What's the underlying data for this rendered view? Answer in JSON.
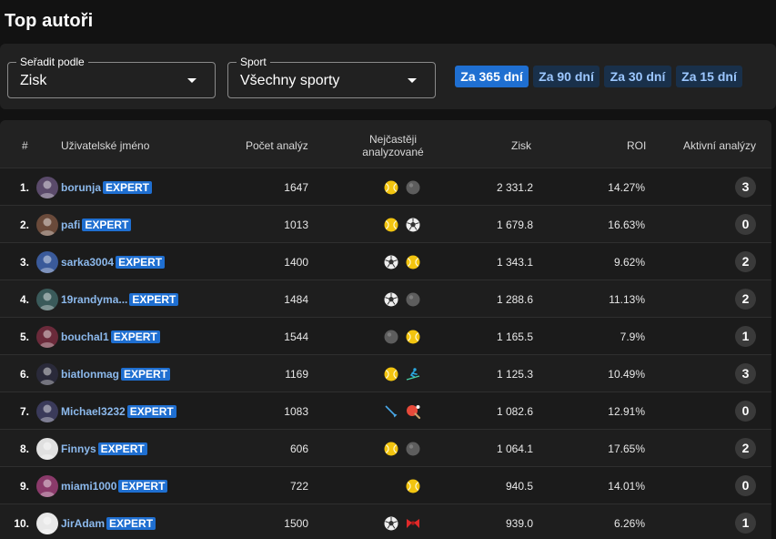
{
  "page": {
    "title": "Top autoři"
  },
  "filters": {
    "sort": {
      "label": "Seřadit podle",
      "value": "Zisk"
    },
    "sport": {
      "label": "Sport",
      "value": "Všechny sporty"
    },
    "periods": [
      {
        "label": "Za 365 dní",
        "active": true
      },
      {
        "label": "Za 90 dní",
        "active": false
      },
      {
        "label": "Za 30 dní",
        "active": false
      },
      {
        "label": "Za 15 dní",
        "active": false
      }
    ]
  },
  "table": {
    "headers": {
      "rank": "#",
      "username": "Uživatelské jméno",
      "count": "Počet analýz",
      "most_line1": "Nejčastěji",
      "most_line2": "analyzované",
      "profit": "Zisk",
      "roi": "ROI",
      "active": "Aktivní analýzy"
    },
    "badge": "EXPERT",
    "rows": [
      {
        "rank": "1.",
        "user": "borunja",
        "count": "1647",
        "sports": [
          "tennis-ball-icon",
          "ball-icon"
        ],
        "profit": "2 331.2",
        "roi": "14.27%",
        "active": "3"
      },
      {
        "rank": "2.",
        "user": "pafi",
        "count": "1013",
        "sports": [
          "tennis-ball-icon",
          "soccer-ball-icon"
        ],
        "profit": "1 679.8",
        "roi": "16.63%",
        "active": "0"
      },
      {
        "rank": "3.",
        "user": "sarka3004",
        "count": "1400",
        "sports": [
          "soccer-ball-icon",
          "tennis-ball-icon"
        ],
        "profit": "1 343.1",
        "roi": "9.62%",
        "active": "2"
      },
      {
        "rank": "4.",
        "user": "19randyma...",
        "count": "1484",
        "sports": [
          "soccer-ball-icon",
          "ball-icon"
        ],
        "profit": "1 288.6",
        "roi": "11.13%",
        "active": "2"
      },
      {
        "rank": "5.",
        "user": "bouchal1",
        "count": "1544",
        "sports": [
          "ball-icon",
          "tennis-ball-icon"
        ],
        "profit": "1 165.5",
        "roi": "7.9%",
        "active": "1"
      },
      {
        "rank": "6.",
        "user": "biatlonmag",
        "count": "1169",
        "sports": [
          "tennis-ball-icon",
          "skier-icon"
        ],
        "profit": "1 125.3",
        "roi": "10.49%",
        "active": "3"
      },
      {
        "rank": "7.",
        "user": "Michael3232",
        "count": "1083",
        "sports": [
          "badminton-icon",
          "table-tennis-icon"
        ],
        "profit": "1 082.6",
        "roi": "12.91%",
        "active": "0"
      },
      {
        "rank": "8.",
        "user": "Finnys",
        "count": "606",
        "sports": [
          "tennis-ball-icon",
          "ball-icon"
        ],
        "profit": "1 064.1",
        "roi": "17.65%",
        "active": "2"
      },
      {
        "rank": "9.",
        "user": "miami1000",
        "count": "722",
        "sports": [
          "tennis-ball-icon"
        ],
        "profit": "940.5",
        "roi": "14.01%",
        "active": "0"
      },
      {
        "rank": "10.",
        "user": "JirAdam",
        "count": "1500",
        "sports": [
          "soccer-ball-icon",
          "bowtie-icon"
        ],
        "profit": "939.0",
        "roi": "6.26%",
        "active": "1"
      }
    ]
  }
}
